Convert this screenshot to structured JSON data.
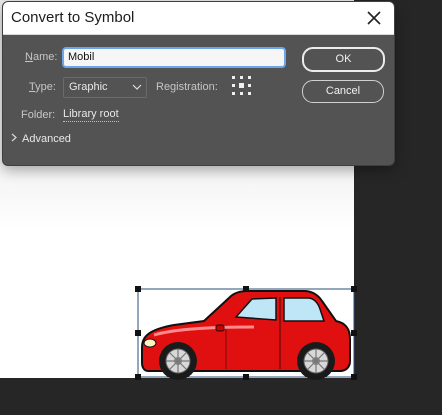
{
  "dialog": {
    "title": "Convert to Symbol",
    "name_label_prefix": "N",
    "name_label_rest": "ame:",
    "name_value": "Mobil",
    "type_label_prefix": "T",
    "type_label_rest": "ype:",
    "type_value": "Graphic",
    "registration_label": "Registration:",
    "folder_label": "Folder:",
    "folder_value": "Library root",
    "advanced_label": "Advanced",
    "ok_label": "OK",
    "cancel_label": "Cancel"
  },
  "icons": {
    "close": "close-icon",
    "dropdown": "chevron-down-icon",
    "registration": "registration-grid-icon",
    "advanced": "chevron-right-icon"
  },
  "colors": {
    "dialog_bg": "#535353",
    "input_focus": "#6ea4ea",
    "car_body": "#e01010",
    "selection": "#1a1a1a"
  }
}
